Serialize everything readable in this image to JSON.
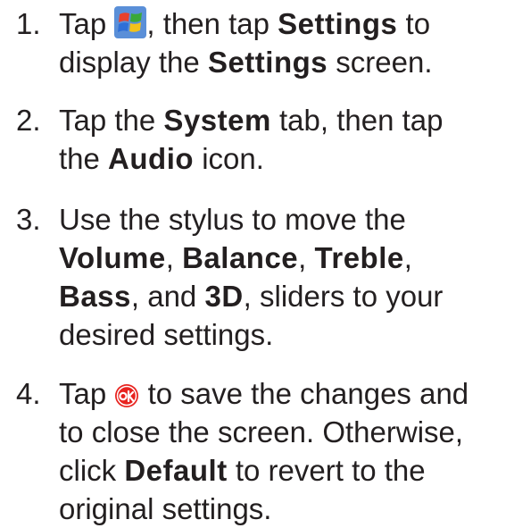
{
  "steps": [
    {
      "number": "1.",
      "line1_a": "Tap",
      "line1_icon": "windows-start-icon",
      "line1_b": ", then tap",
      "line1_bold": "Settings",
      "line1_c": "to",
      "line2_a": "display the",
      "line2_bold": "Settings",
      "line2_b": "screen."
    },
    {
      "number": "2.",
      "line1_a": "Tap the",
      "line1_bold": "System",
      "line1_b": "tab, then tap",
      "line2_a": "the",
      "line2_bold": "Audio",
      "line2_b": "icon."
    },
    {
      "number": "3.",
      "line1": "Use the stylus to move the",
      "b1": "Volume",
      "b2": "Balance",
      "b3": "Treble",
      "b4": "Bass",
      "b5": "3D",
      "and_text": ", and",
      "line3_tail": ", sliders to your",
      "line4": "desired settings."
    },
    {
      "number": "4.",
      "line1_a": "Tap",
      "line1_icon": "ok-icon",
      "line1_b": "to save the changes and",
      "line2": "to close the screen. Otherwise,",
      "line3_a": "click",
      "line3_bold": "Default",
      "line3_b": "to revert to the",
      "line4": "original settings."
    }
  ],
  "icon_colors": {
    "ok_red": "#e8231f",
    "flag_red": "#e8412c",
    "flag_green": "#3aa83a",
    "flag_blue": "#2e6fd8",
    "flag_yellow": "#f2c21b",
    "tile_blue": "#5a8fd8"
  }
}
